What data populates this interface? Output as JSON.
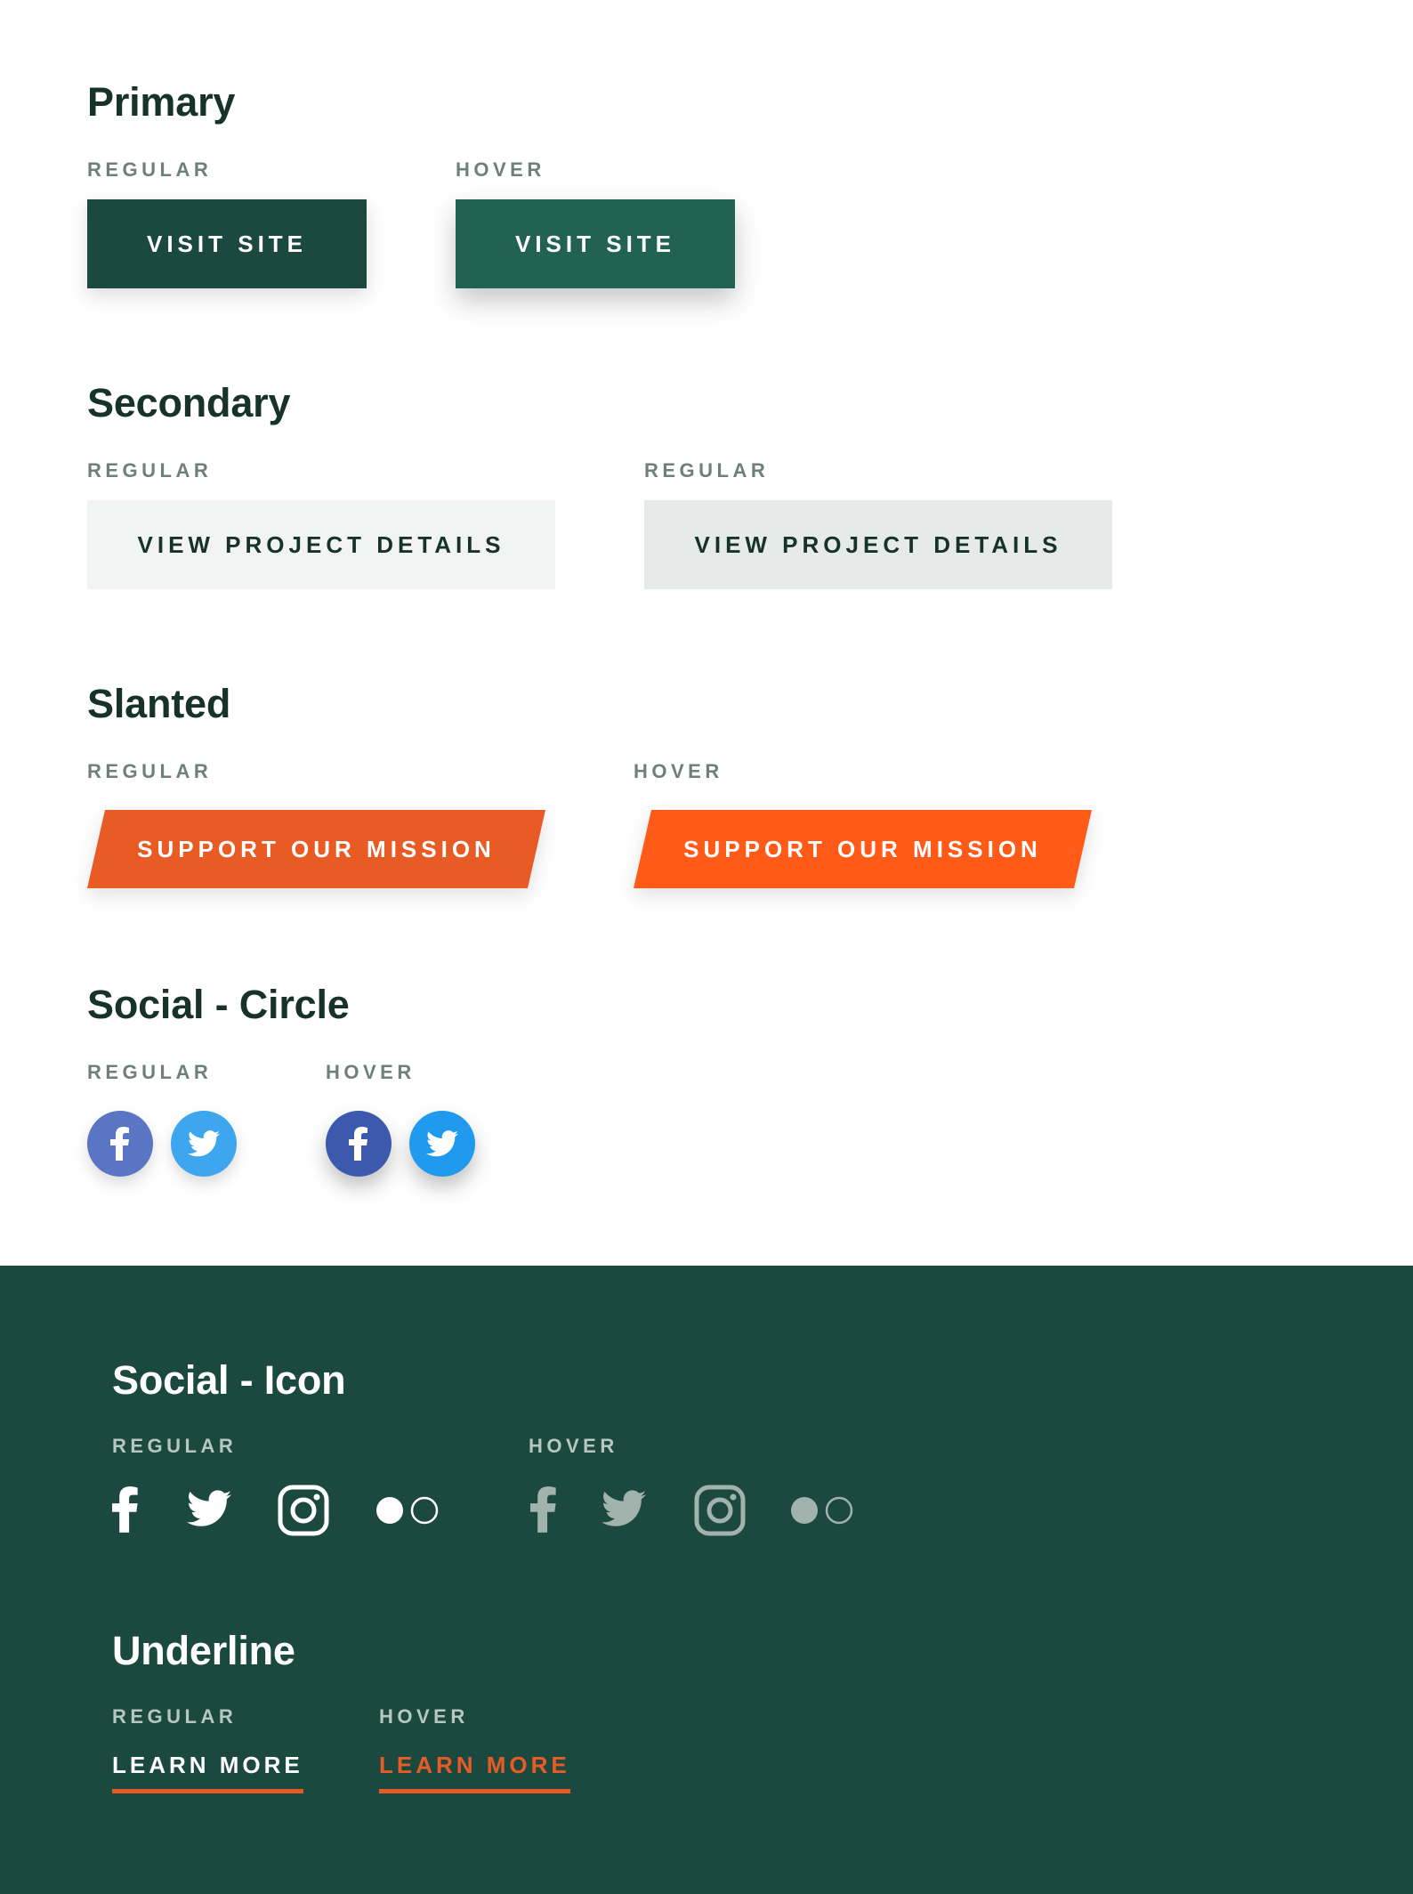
{
  "primary": {
    "heading": "Primary",
    "regular_label": "REGULAR",
    "hover_label": "HOVER",
    "regular_button": "VISIT SITE",
    "hover_button": "VISIT SITE"
  },
  "secondary": {
    "heading": "Secondary",
    "regular_label": "REGULAR",
    "hover_label": "REGULAR",
    "regular_button": "VIEW PROJECT DETAILS",
    "hover_button": "VIEW PROJECT DETAILS"
  },
  "slanted": {
    "heading": "Slanted",
    "regular_label": "REGULAR",
    "hover_label": "HOVER",
    "regular_button": "SUPPORT OUR MISSION",
    "hover_button": "SUPPORT OUR MISSION"
  },
  "social_circle": {
    "heading": "Social - Circle",
    "regular_label": "REGULAR",
    "hover_label": "HOVER",
    "icons": [
      "facebook-icon",
      "twitter-icon"
    ]
  },
  "social_icon": {
    "heading": "Social - Icon",
    "regular_label": "REGULAR",
    "hover_label": "HOVER",
    "icons": [
      "facebook-icon",
      "twitter-icon",
      "instagram-icon",
      "flickr-icon"
    ]
  },
  "underline": {
    "heading": "Underline",
    "regular_label": "REGULAR",
    "hover_label": "HOVER",
    "regular_link": "LEARN MORE",
    "hover_link": "LEARN MORE"
  },
  "colors": {
    "dark_green": "#1b483f",
    "hover_green": "#216252",
    "orange": "#e85b24",
    "orange_hover": "#ff5a18",
    "facebook": "#5a75c4",
    "twitter": "#3ea6ef"
  }
}
